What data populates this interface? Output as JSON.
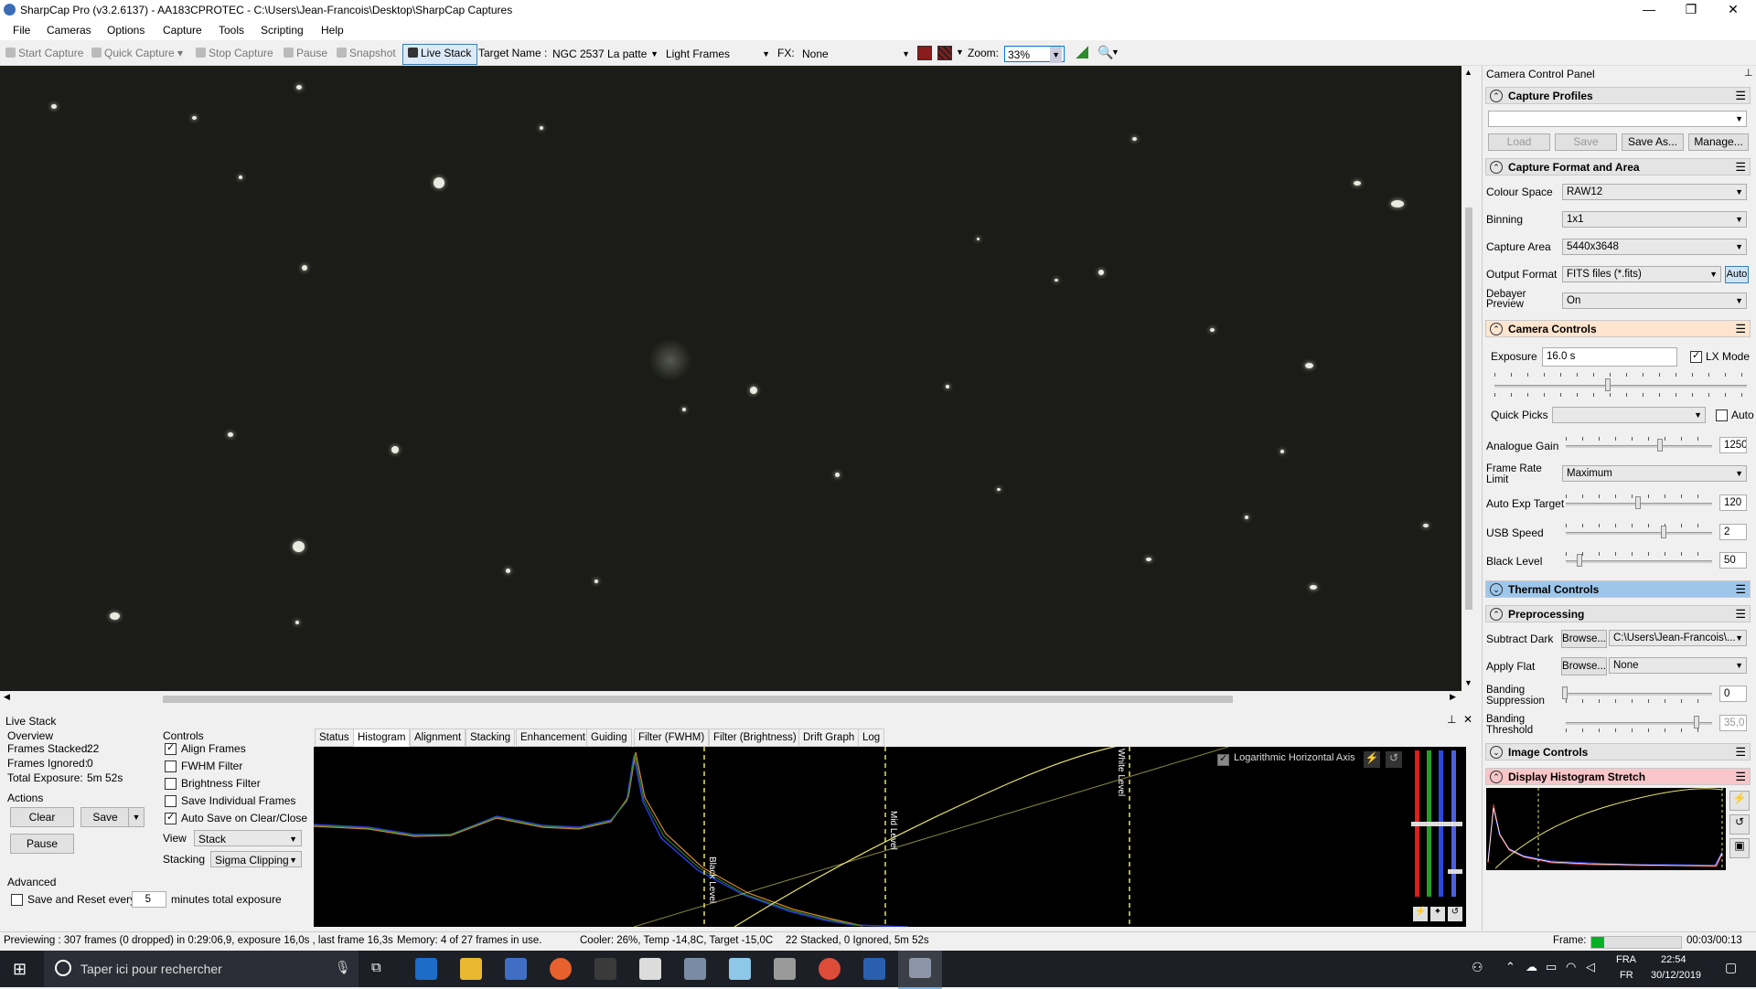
{
  "window": {
    "title": "SharpCap Pro (v3.2.6137) - AA183CPROTEC - C:\\Users\\Jean-Francois\\Desktop\\SharpCap Captures",
    "minimize": "—",
    "maximize": "❐",
    "close": "✕"
  },
  "menu": [
    "File",
    "Cameras",
    "Options",
    "Capture",
    "Tools",
    "Scripting",
    "Help"
  ],
  "toolbar": {
    "start_capture": "Start Capture",
    "quick_capture": "Quick Capture",
    "stop_capture": "Stop Capture",
    "pause": "Pause",
    "snapshot": "Snapshot",
    "live_stack": "Live Stack",
    "target_label": "Target Name :",
    "target_value": "NGC 2537 La patte",
    "frame_type": "Light Frames",
    "fx_label": "FX:",
    "fx_value": "None",
    "zoom_label": "Zoom:",
    "zoom_value": "33%"
  },
  "live_stack": {
    "title": "Live Stack",
    "overview_label": "Overview",
    "frames_stacked_label": "Frames Stacked:",
    "frames_stacked": "22",
    "frames_ignored_label": "Frames Ignored:",
    "frames_ignored": "0",
    "total_exposure_label": "Total Exposure:",
    "total_exposure": "5m 52s",
    "actions_label": "Actions",
    "clear": "Clear",
    "save": "Save",
    "pause": "Pause",
    "advanced_label": "Advanced",
    "save_reset_label": "Save and Reset every",
    "save_reset_value": "5",
    "save_reset_suffix": "minutes total exposure",
    "controls_label": "Controls",
    "align_frames": "Align Frames",
    "fwhm_filter": "FWHM Filter",
    "brightness_filter": "Brightness Filter",
    "save_individual": "Save Individual Frames",
    "auto_save": "Auto Save on Clear/Close",
    "view_label": "View",
    "view_value": "Stack",
    "stacking_label": "Stacking",
    "stacking_value": "Sigma Clipping",
    "tabs": [
      "Status",
      "Histogram",
      "Alignment",
      "Stacking",
      "Enhancement",
      "Guiding",
      "Filter (FWHM)",
      "Filter (Brightness)",
      "Drift Graph",
      "Log"
    ],
    "active_tab": "Histogram",
    "log_axis": "Logarithmic Horizontal Axis",
    "black_level": "Black Level",
    "mid_level": "Mid Level",
    "white_level": "White Level"
  },
  "statusbar": {
    "previewing": "Previewing : 307 frames (0 dropped) in 0:29:06,9, exposure 16,0s , last frame 16,3s",
    "memory": "Memory: 4 of 27 frames in use.",
    "cooler": "Cooler: 26%, Temp -14,8C, Target -15,0C",
    "stacked": "22 Stacked, 0 Ignored, 5m 52s",
    "frame_label": "Frame:",
    "frame_time": "00:03/00:13"
  },
  "panel": {
    "title": "Camera Control Panel",
    "capture_profiles": "Capture Profiles",
    "load": "Load",
    "save": "Save",
    "save_as": "Save As...",
    "manage": "Manage...",
    "capture_format": "Capture Format and Area",
    "colour_space_label": "Colour Space",
    "colour_space": "RAW12",
    "binning_label": "Binning",
    "binning": "1x1",
    "capture_area_label": "Capture Area",
    "capture_area": "5440x3648",
    "output_format_label": "Output Format",
    "output_format": "FITS files (*.fits)",
    "auto": "Auto",
    "debayer_label": "Debayer Preview",
    "debayer": "On",
    "camera_controls": "Camera Controls",
    "exposure_label": "Exposure",
    "exposure": "16.0 s",
    "lx_mode": "LX Mode",
    "quick_picks_label": "Quick Picks",
    "quick_picks_auto": "Auto",
    "analogue_gain_label": "Analogue Gain",
    "analogue_gain": "1250",
    "frame_rate_label": "Frame Rate Limit",
    "frame_rate": "Maximum",
    "auto_exp_label": "Auto Exp Target",
    "auto_exp": "120",
    "usb_speed_label": "USB Speed",
    "usb_speed": "2",
    "black_level_label": "Black Level",
    "black_level": "50",
    "thermal_controls": "Thermal Controls",
    "preprocessing": "Preprocessing",
    "subtract_dark_label": "Subtract Dark",
    "browse": "Browse...",
    "subtract_dark": "C:\\Users\\Jean-Francois\\...",
    "apply_flat_label": "Apply Flat",
    "apply_flat": "None",
    "banding_supp_label": "Banding Suppression",
    "banding_supp": "0",
    "banding_thresh_label": "Banding Threshold",
    "banding_thresh": "35,0",
    "image_controls": "Image Controls",
    "display_histogram": "Display Histogram Stretch"
  },
  "taskbar": {
    "search_placeholder": "Taper ici pour rechercher",
    "lang_top": "FRA",
    "lang_bottom": "FR",
    "time": "22:54",
    "date": "30/12/2019"
  },
  "colors": {
    "thermal_header": "#9dc6ea",
    "camera_controls_header": "#fde5cf",
    "display_hist_header": "#f8c6c9",
    "guide_line": "#e6e36a"
  }
}
